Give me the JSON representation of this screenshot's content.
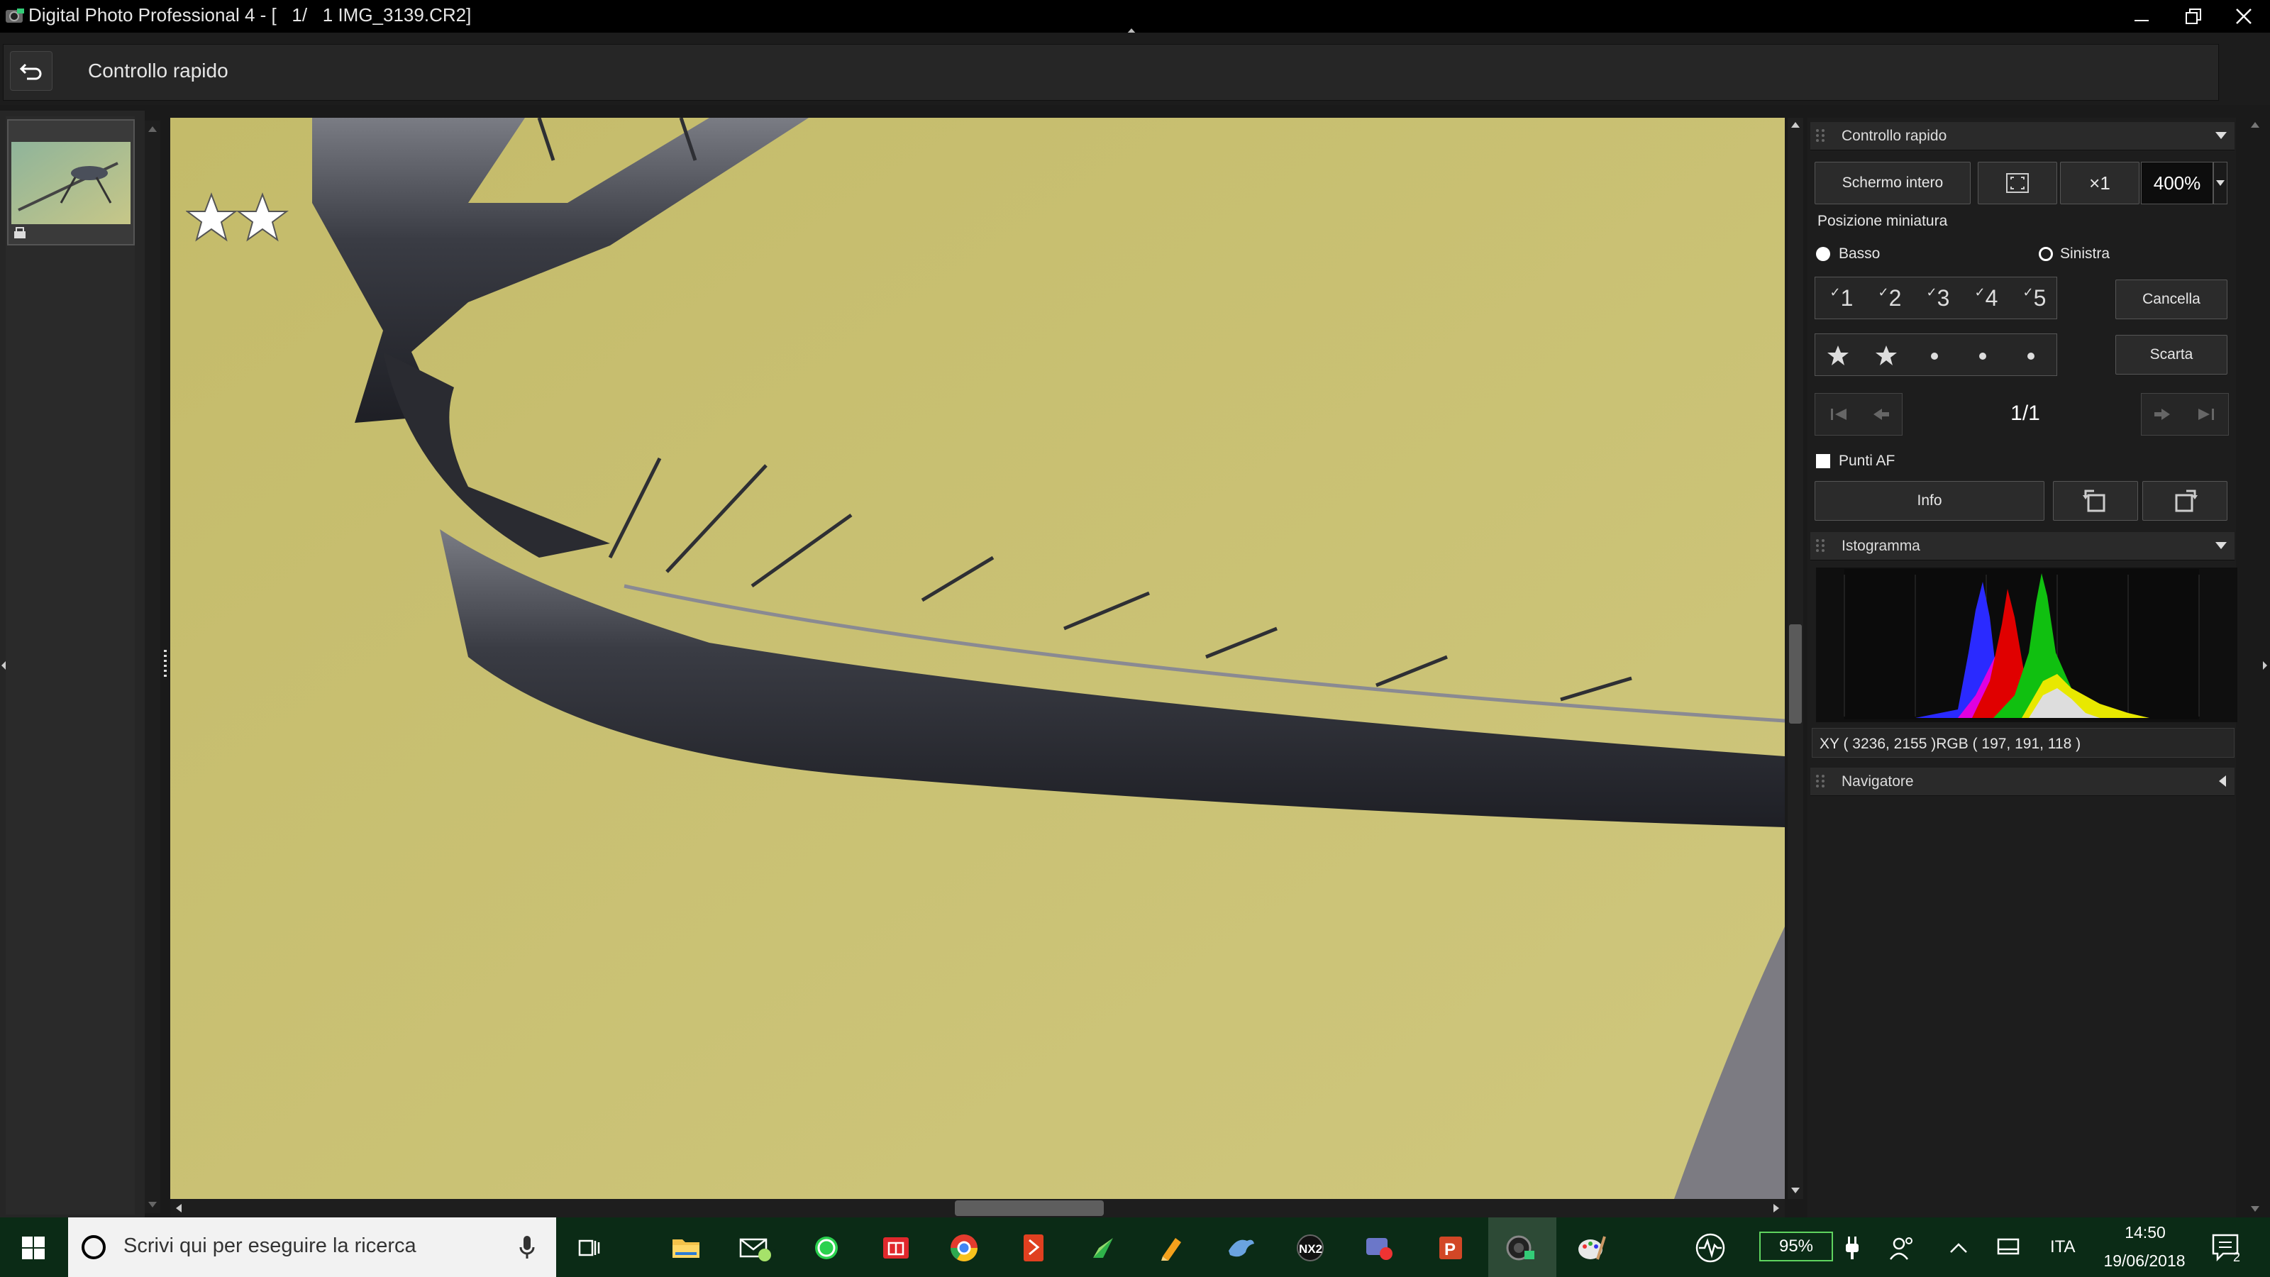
{
  "window": {
    "title": "Digital Photo Professional 4 - [   1/   1 IMG_3139.CR2]"
  },
  "toolbar": {
    "view_title": "Controllo rapido"
  },
  "image": {
    "rating_stars": 2
  },
  "quick_check_panel": {
    "title": "Controllo rapido",
    "fullscreen_label": "Schermo intero",
    "zoom_x1_label": "×1",
    "zoom_value": "400%",
    "thumb_position_label": "Posizione miniatura",
    "radio_bottom": "Basso",
    "radio_left": "Sinistra",
    "check_marks": [
      "1",
      "2",
      "3",
      "4",
      "5"
    ],
    "cancel_label": "Cancella",
    "reject_label": "Scarta",
    "page_counter": "1/1",
    "af_points_label": "Punti AF",
    "info_label": "Info"
  },
  "histogram_panel": {
    "title": "Istogramma",
    "readout": "XY ( 3236, 2155 )RGB ( 197, 191, 118 )"
  },
  "navigator_panel": {
    "title": "Navigatore"
  },
  "taskbar": {
    "search_placeholder": "Scrivi qui per eseguire la ricerca",
    "mail_badge": "1",
    "notification_badge": "2",
    "battery": "95%",
    "language": "ITA",
    "time": "14:50",
    "date": "19/06/2018"
  },
  "colors": {
    "background": "#c9c172",
    "panel": "#1d1d1d",
    "taskbar": "#0b2b16",
    "battery_outline": "#5fd45f"
  }
}
